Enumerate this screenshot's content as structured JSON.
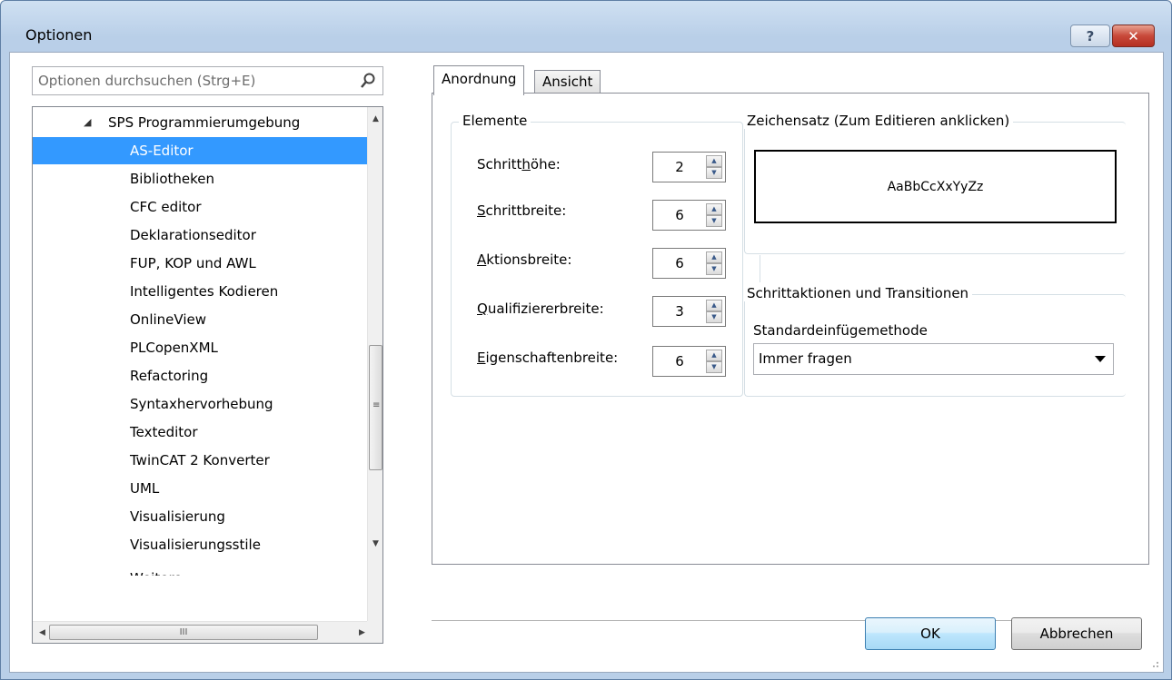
{
  "window": {
    "title": "Optionen",
    "help_label": "?",
    "close_label": "✕"
  },
  "search": {
    "placeholder": "Optionen durchsuchen (Strg+E)",
    "icon": "search-icon"
  },
  "tree": {
    "parent": "SPS Programmierumgebung",
    "items": [
      "AS-Editor",
      "Bibliotheken",
      "CFC editor",
      "Deklarationseditor",
      "FUP, KOP und AWL",
      "Intelligentes Kodieren",
      "OnlineView",
      "PLCopenXML",
      "Refactoring",
      "Syntaxhervorhebung",
      "Texteditor",
      "TwinCAT 2 Konverter",
      "UML",
      "Visualisierung",
      "Visualisierungsstile",
      "Weitere..."
    ],
    "selected": "AS-Editor"
  },
  "tabs": [
    {
      "label": "Anordnung",
      "active": true
    },
    {
      "label": "Ansicht",
      "active": false
    }
  ],
  "elemente": {
    "title": "Elemente",
    "fields": [
      {
        "label_pre": "Schritt",
        "label_u": "h",
        "label_post": "öhe:",
        "value": "2"
      },
      {
        "label_pre": "",
        "label_u": "S",
        "label_post": "chrittbreite:",
        "value": "6"
      },
      {
        "label_pre": "",
        "label_u": "A",
        "label_post": "ktionsbreite:",
        "value": "6"
      },
      {
        "label_pre": "",
        "label_u": "Q",
        "label_post": "ualifiziererbreite:",
        "value": "3"
      },
      {
        "label_pre": "",
        "label_u": "E",
        "label_post": "igenschaftenbreite:",
        "value": "6"
      }
    ]
  },
  "font": {
    "title": "Zeichensatz (Zum Editieren anklicken)",
    "sample": "AaBbCcXxYyZz"
  },
  "transitions": {
    "title": "Schrittaktionen und Transitionen",
    "method_label": "Standardeinfügemethode",
    "method_value": "Immer fragen"
  },
  "buttons": {
    "ok": "OK",
    "cancel": "Abbrechen"
  }
}
